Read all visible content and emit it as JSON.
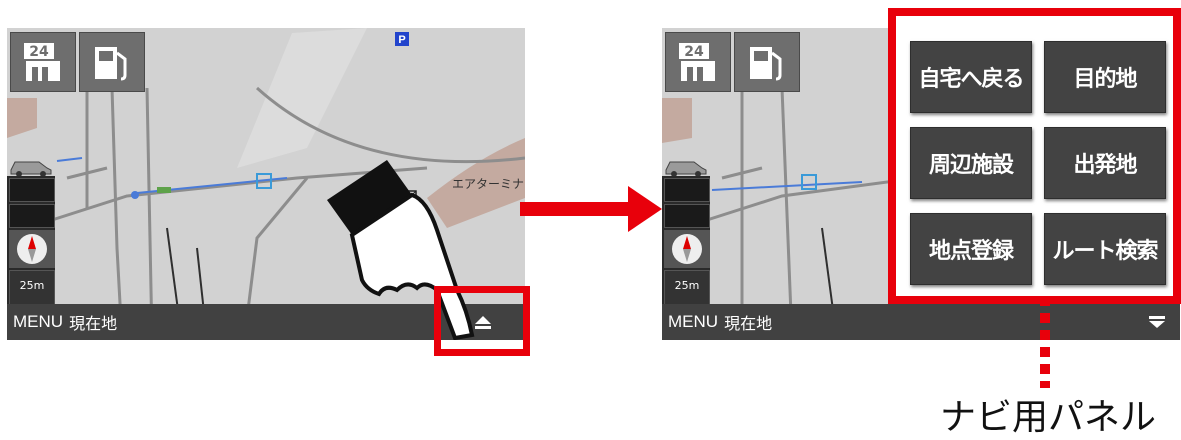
{
  "left_screen": {
    "menu_label": "MENU",
    "location_label": "現在地",
    "map_place_label": "エアターミナ",
    "scale_label": "25m",
    "convenience_store_number": "24",
    "parking_label": "P"
  },
  "right_screen": {
    "menu_label": "MENU",
    "location_label": "現在地",
    "scale_label": "25m",
    "convenience_store_number": "24"
  },
  "nav_panel": {
    "buttons": [
      {
        "label": "自宅へ戻る"
      },
      {
        "label": "目的地"
      },
      {
        "label": "周辺施設"
      },
      {
        "label": "出発地"
      },
      {
        "label": "地点登録"
      },
      {
        "label": "ルート検索"
      }
    ]
  },
  "caption": "ナビ用パネル",
  "colors": {
    "highlight_red": "#e8000b",
    "bar_gray": "#414141",
    "map_gray": "#d2d2d2"
  },
  "icons": [
    "convenience-store-icon",
    "gas-station-icon",
    "compass-icon",
    "car-icon",
    "eject-icon",
    "collapse-icon",
    "pointing-hand-icon"
  ]
}
